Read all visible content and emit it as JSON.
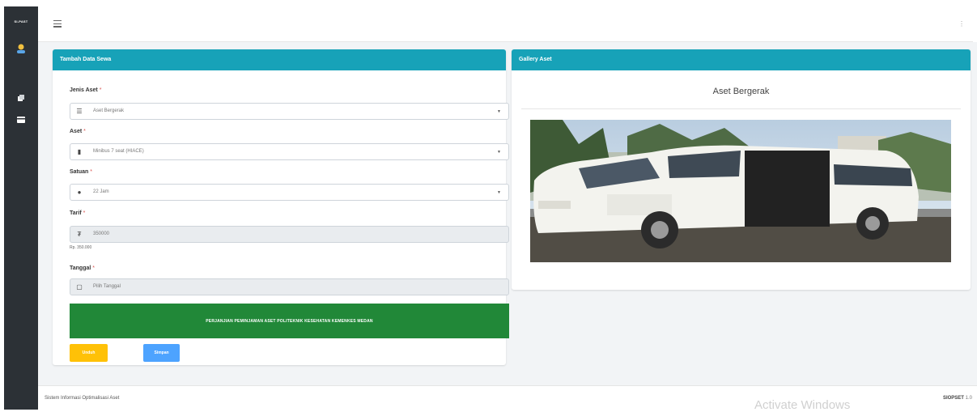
{
  "sidebar": {
    "brand": "SI-PAST",
    "avatar_icon": "user-avatar-icon",
    "nav_icons": [
      "folders-icon",
      "card-icon"
    ]
  },
  "topbar": {
    "menu_icon": "hamburger-icon",
    "right_icon": "user-menu-icon"
  },
  "form": {
    "header": "Tambah Data Sewa",
    "jenis_label": "Jenis Aset",
    "jenis_value": "Aset Bergerak",
    "aset_label": "Aset",
    "aset_value": "Minibus 7 seat (HIACE)",
    "satuan_label": "Satuan",
    "satuan_value": "22 Jam",
    "tarif_label": "Tarif",
    "tarif_value": "350000",
    "tarif_hint": "Rp. 350.000",
    "tanggal_label": "Tanggal",
    "tanggal_placeholder": "Pilih Tanggal",
    "required_mark": "*",
    "banner": "PERJANJIAN PEMINJAMAN ASET POLITEKNIK KESEHATAN KEMENKES MEDAN",
    "btn_left": "Unduh",
    "btn_right": "Simpan"
  },
  "gallery": {
    "header": "Gallery Aset",
    "title": "Aset Bergerak"
  },
  "footer": {
    "left": "Sistem Informasi Optimalisasi Aset",
    "watermark": "Activate Windows",
    "right_brand": "SIOPSET",
    "right_version": "1.0"
  },
  "colors": {
    "sidebar": "#2c3136",
    "header_teal": "#17a2b8",
    "banner_green": "#218838",
    "btn_warning": "#ffc107",
    "btn_primary": "#4da3ff"
  }
}
